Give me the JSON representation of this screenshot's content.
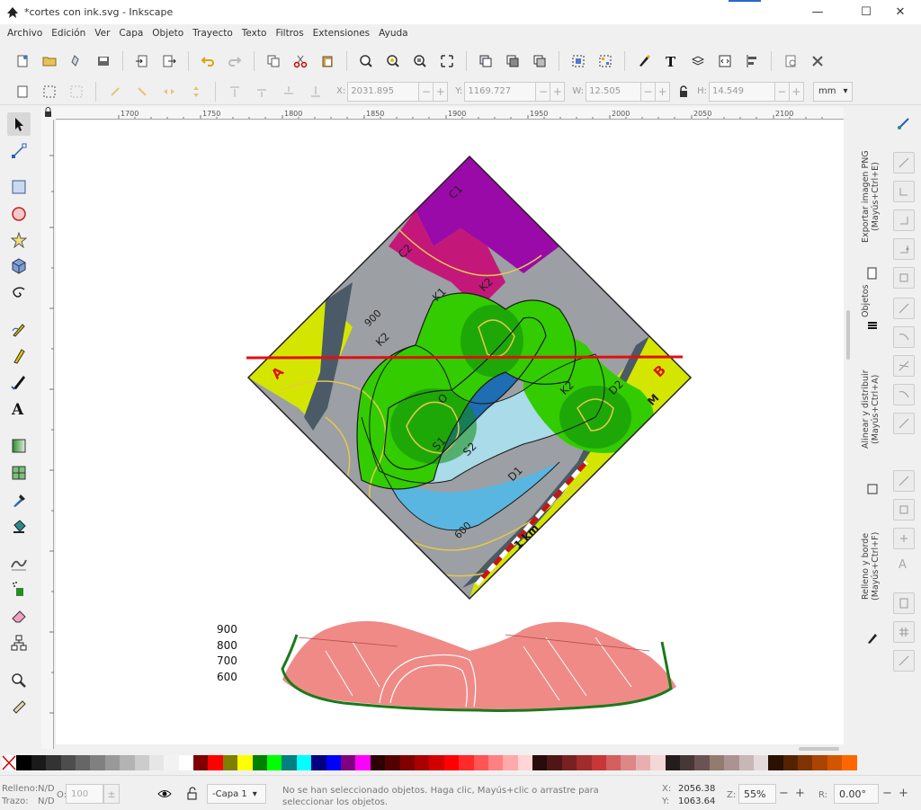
{
  "window": {
    "title": "*cortes con ink.svg - Inkscape",
    "minimize": "—",
    "maximize": "☐",
    "close": "✕"
  },
  "menu": [
    "Archivo",
    "Edición",
    "Ver",
    "Capa",
    "Objeto",
    "Trayecto",
    "Texto",
    "Filtros",
    "Extensiones",
    "Ayuda"
  ],
  "controls": {
    "x_label": "X:",
    "x_value": "2031.895",
    "y_label": "Y:",
    "y_value": "1169.727",
    "w_label": "W:",
    "w_value": "12.505",
    "h_label": "H:",
    "h_value": "14.549",
    "unit": "mm"
  },
  "ruler": {
    "ticks": [
      "1700",
      "1750",
      "1800",
      "1850",
      "1900",
      "1950",
      "2000",
      "2050",
      "2100"
    ]
  },
  "map": {
    "labels": [
      "C1",
      "C2",
      "K1",
      "K2",
      "K2",
      "K2",
      "900",
      "O",
      "S1",
      "S2",
      "D1",
      "D2",
      "M",
      "600",
      "1 km"
    ],
    "end_a": "A",
    "end_b": "B"
  },
  "profile": {
    "axis_labels": [
      "900",
      "800",
      "700",
      "600"
    ]
  },
  "dock": {
    "tabs": [
      "Exportar imagen PNG (Mayús+Ctrl+E)",
      "Objetos",
      "Alinear y distribuir (Mayús+Ctrl+A)",
      "Relleno y borde (Mayús+Ctrl+F)"
    ]
  },
  "colors": {
    "purple": "#9a0aa8",
    "magenta": "#c4177a",
    "green_light": "#33cc00",
    "green_dark": "#0c8a0c",
    "blue_dark": "#1f6db3",
    "blue_mid": "#59b6e0",
    "blue_light": "#a9dbe8",
    "grey": "#9c9fa3",
    "slate": "#4a5a66",
    "yellow_green": "#d4e600",
    "contour": "#e6c84d",
    "section_line": "#e01010",
    "profile_fill": "#f08a86",
    "profile_edge": "#1a7a1a"
  },
  "palette": [
    "#000000",
    "#1a1a1a",
    "#333333",
    "#4d4d4d",
    "#666666",
    "#808080",
    "#999999",
    "#b3b3b3",
    "#cccccc",
    "#e6e6e6",
    "#f2f2f2",
    "#ffffff",
    "#800000",
    "#ff0000",
    "#808000",
    "#ffff00",
    "#008000",
    "#00ff00",
    "#008080",
    "#00ffff",
    "#000080",
    "#0000ff",
    "#800080",
    "#ff00ff",
    "#2b0000",
    "#550000",
    "#800000",
    "#aa0000",
    "#d40000",
    "#ff0000",
    "#ff2a2a",
    "#ff5555",
    "#ff8080",
    "#ffaaaa",
    "#ffd5d5",
    "#280b0b",
    "#501616",
    "#782121",
    "#a02c2c",
    "#c83737",
    "#d35f5f",
    "#de8787",
    "#e9afaf",
    "#f4d7d7",
    "#241c1c",
    "#483737",
    "#6c5353",
    "#917c6f",
    "#ac9393",
    "#c8b7b7",
    "#e3dbdb",
    "#2b1100",
    "#552200",
    "#803300",
    "#aa4400",
    "#d45500",
    "#ff6600"
  ],
  "status": {
    "fill_label": "Relleno:",
    "fill_value": "N/D",
    "stroke_label": "Trazo:",
    "stroke_value": "N/D",
    "opacity_label": "O:",
    "opacity_value": "100",
    "layer": "-Capa 1",
    "message": "No se han seleccionado objetos. Haga clic, Mayús+clic o arrastre para seleccionar los objetos.",
    "cursor_x_label": "X:",
    "cursor_x": "2056.38",
    "cursor_y_label": "Y:",
    "cursor_y": "1063.64",
    "zoom_label": "Z:",
    "zoom": "55%",
    "rotation_label": "R:",
    "rotation": "0.00°"
  }
}
